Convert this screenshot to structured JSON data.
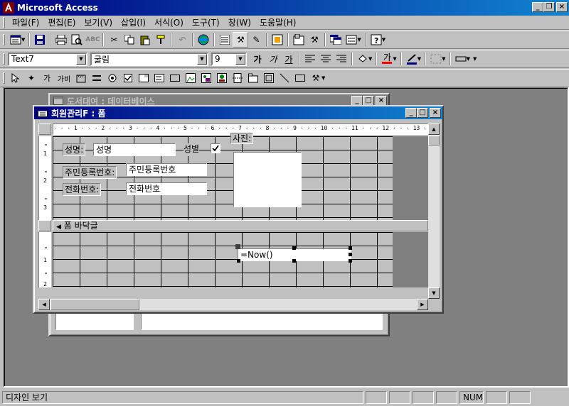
{
  "app": {
    "title": "Microsoft Access",
    "accent": "#000080"
  },
  "menu": [
    {
      "label": "파일(F)"
    },
    {
      "label": "편집(E)"
    },
    {
      "label": "보기(V)"
    },
    {
      "label": "삽입(I)"
    },
    {
      "label": "서식(O)"
    },
    {
      "label": "도구(T)"
    },
    {
      "label": "창(W)"
    },
    {
      "label": "도움말(H)"
    }
  ],
  "format_toolbar": {
    "object_combo": "Text7",
    "font_combo": "굴림",
    "size_combo": "9",
    "bold": "가",
    "italic": "가",
    "underline": "가",
    "font_color_glyph": "가"
  },
  "toolbox": {
    "label_tool": "가",
    "textbox_tool": "가비"
  },
  "bg_window": {
    "title": "도서대여 : 데이터베이스"
  },
  "form_window": {
    "title": "회원관리F : 폼",
    "ruler_text": "· · · 1 · · · 2 · · · 3 · · · 4 · · · 5 · · · 6 · · · 7 · · · 8 · · · 9 · · · 10 · · · 11 · · · 12 · · · 13 · · ·",
    "detail": {
      "name_label": "성명:",
      "name_value": "성명",
      "gender_label": "성별",
      "photo_label": "사진:",
      "ssn_label": "주민등록번호:",
      "ssn_value": "주민등록번호",
      "phone_label": "전화번호:",
      "phone_value": "전화번호"
    },
    "footer": {
      "section_label": "폼 바닥글",
      "now_value": "=Now()"
    }
  },
  "statusbar": {
    "mode": "디자인 보기",
    "num": "NUM"
  }
}
